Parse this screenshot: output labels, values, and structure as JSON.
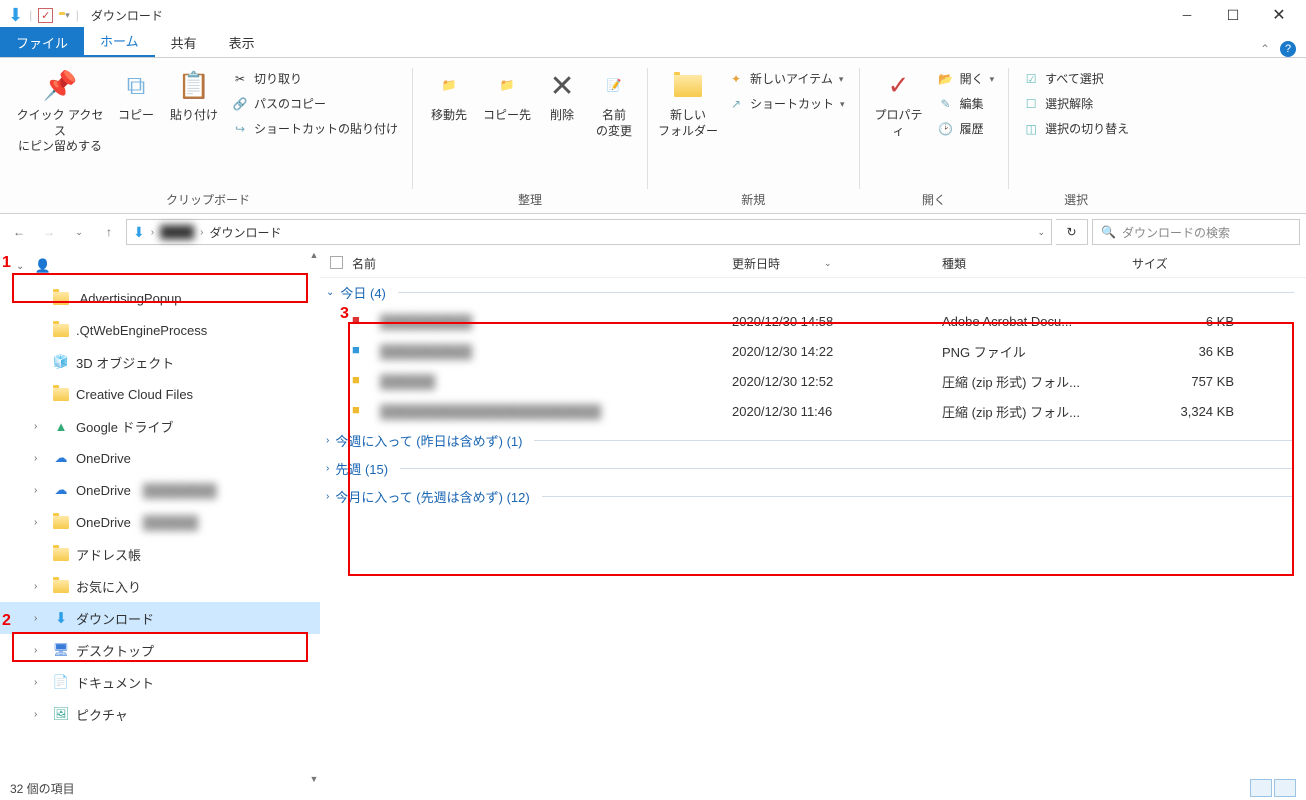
{
  "window_title": "ダウンロード",
  "tabs": {
    "file": "ファイル",
    "home": "ホーム",
    "share": "共有",
    "view": "表示"
  },
  "ribbon": {
    "pin": "クイック アクセス\nにピン留めする",
    "copy": "コピー",
    "paste": "貼り付け",
    "cut": "切り取り",
    "copypath": "パスのコピー",
    "pastelnk": "ショートカットの貼り付け",
    "clipboard": "クリップボード",
    "moveto": "移動先",
    "copyto": "コピー先",
    "delete": "削除",
    "rename": "名前\nの変更",
    "organize": "整理",
    "newfolder": "新しい\nフォルダー",
    "newitem": "新しいアイテム",
    "shortcut": "ショートカット",
    "new": "新規",
    "properties": "プロパティ",
    "open": "開く",
    "edit": "編集",
    "history": "履歴",
    "opengrp": "開く",
    "selectall": "すべて選択",
    "selectnone": "選択解除",
    "selectinv": "選択の切り替え",
    "select": "選択"
  },
  "breadcrumb": {
    "current": "ダウンロード"
  },
  "search_placeholder": "ダウンロードの検索",
  "columns": {
    "name": "名前",
    "date": "更新日時",
    "type": "種類",
    "size": "サイズ"
  },
  "nav": {
    "user": "",
    "items": [
      ".AdvertisingPopup",
      ".QtWebEngineProcess",
      "3D オブジェクト",
      "Creative Cloud Files",
      "Google ドライブ",
      "OneDrive",
      "OneDrive",
      "OneDrive",
      "アドレス帳",
      "お気に入り",
      "ダウンロード",
      "デスクトップ",
      "ドキュメント",
      "ピクチャ"
    ]
  },
  "groups": [
    {
      "label": "今日 (4)",
      "expanded": true
    },
    {
      "label": "今週に入って (昨日は含めず) (1)",
      "expanded": false
    },
    {
      "label": "先週 (15)",
      "expanded": false
    },
    {
      "label": "今月に入って (先週は含めず) (12)",
      "expanded": false
    }
  ],
  "files": [
    {
      "name": "██████████",
      "date": "2020/12/30 14:58",
      "type": "Adobe Acrobat Docu...",
      "size": "6 KB"
    },
    {
      "name": "██████████",
      "date": "2020/12/30 14:22",
      "type": "PNG ファイル",
      "size": "36 KB"
    },
    {
      "name": "██████",
      "date": "2020/12/30 12:52",
      "type": "圧縮 (zip 形式) フォル...",
      "size": "757 KB"
    },
    {
      "name": "████████████████████████",
      "date": "2020/12/30 11:46",
      "type": "圧縮 (zip 形式) フォル...",
      "size": "3,324 KB"
    }
  ],
  "status": "32 個の項目",
  "annotations": {
    "1": "1",
    "2": "2",
    "3": "3"
  }
}
